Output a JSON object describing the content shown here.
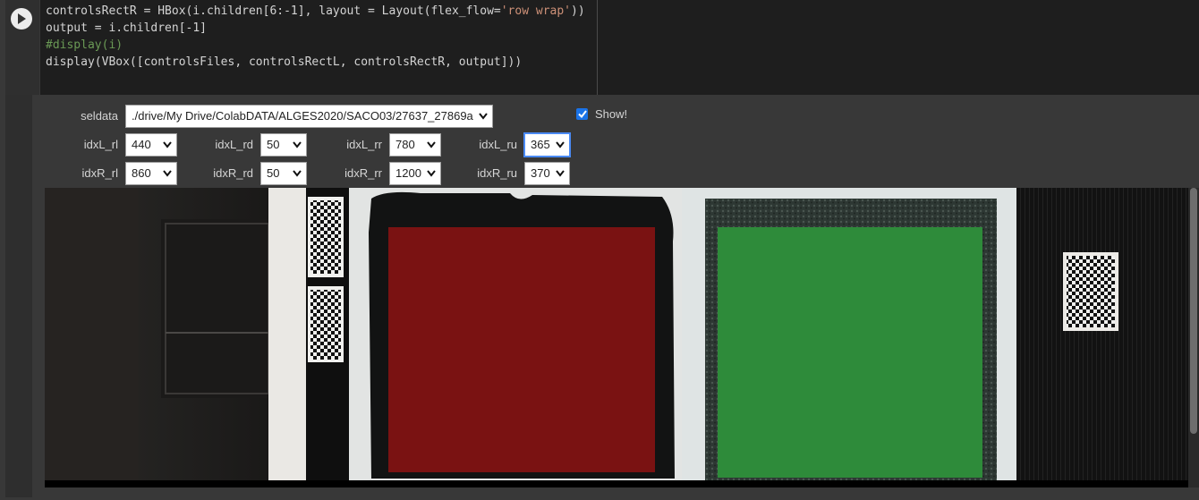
{
  "code": {
    "line1_a": "controlsRectR = HBox(i.children[6:-1], layout = Layout(flex_flow=",
    "line1_str": "'row wrap'",
    "line1_b": "))",
    "line2": "output = i.children[-1]",
    "line3": "#display(i)",
    "line4": "display(VBox([controlsFiles, controlsRectL, controlsRectR, output]))"
  },
  "controls": {
    "seldata_label": "seldata",
    "seldata_value": "./drive/My Drive/ColabDATA/ALGES2020/SACO03/27637_27869a",
    "show_label": "Show!",
    "show_checked": true,
    "row_left": [
      {
        "label": "idxL_rl",
        "value": "440"
      },
      {
        "label": "idxL_rd",
        "value": "50"
      },
      {
        "label": "idxL_rr",
        "value": "780"
      },
      {
        "label": "idxL_ru",
        "value": "365"
      }
    ],
    "row_right": [
      {
        "label": "idxR_rl",
        "value": "860"
      },
      {
        "label": "idxR_rd",
        "value": "50"
      },
      {
        "label": "idxR_rr",
        "value": "1200"
      },
      {
        "label": "idxR_ru",
        "value": "370"
      }
    ]
  },
  "colors": {
    "left_overlay": "#7a1212",
    "right_overlay": "#2e8b3a",
    "checkbox": "#1a73e8"
  },
  "icons": [
    "run-cell-icon",
    "chevron-down-icon",
    "check-icon",
    "qr-code-icon"
  ]
}
